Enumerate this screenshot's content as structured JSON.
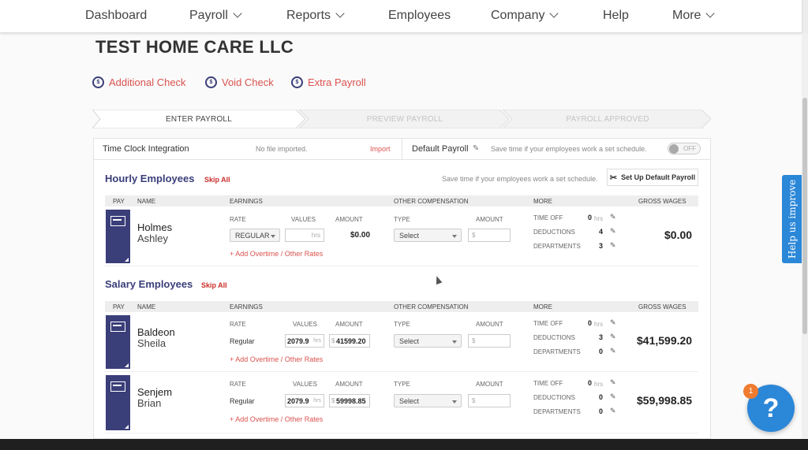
{
  "nav": {
    "items": [
      {
        "label": "Dashboard",
        "has_dropdown": false
      },
      {
        "label": "Payroll",
        "has_dropdown": true
      },
      {
        "label": "Reports",
        "has_dropdown": true
      },
      {
        "label": "Employees",
        "has_dropdown": false
      },
      {
        "label": "Company",
        "has_dropdown": true
      },
      {
        "label": "Help",
        "has_dropdown": false
      },
      {
        "label": "More",
        "has_dropdown": true
      }
    ]
  },
  "company_name": "TEST HOME CARE LLC",
  "actions": {
    "additional_check": "Additional Check",
    "void_check": "Void Check",
    "extra_payroll": "Extra Payroll"
  },
  "steps": {
    "enter": "ENTER PAYROLL",
    "preview": "PREVIEW PAYROLL",
    "approved": "PAYROLL APPROVED"
  },
  "timeclock": {
    "label": "Time Clock Integration",
    "status": "No file imported.",
    "import": "Import",
    "default_payroll": "Default Payroll",
    "hint": "Save time if your employees work a set schedule.",
    "toggle": "OFF"
  },
  "hourly": {
    "title": "Hourly Employees",
    "skip_all": "Skip All",
    "hint": "Save time if your employees work a set schedule.",
    "setup_button": "Set Up Default Payroll"
  },
  "salary": {
    "title": "Salary Employees",
    "skip_all": "Skip All"
  },
  "table_headers": {
    "pay": "PAY",
    "name": "NAME",
    "earnings": "EARNINGS",
    "other_comp": "OTHER COMPENSATION",
    "more": "MORE",
    "gross_wages": "GROSS WAGES"
  },
  "sub_headers": {
    "rate": "RATE",
    "values": "VALUES",
    "amount": "AMOUNT",
    "type": "TYPE",
    "time_off": "TIME OFF",
    "deductions": "DEDUCTIONS",
    "departments": "DEPARTMENTS",
    "hrs": "hrs",
    "dollar": "$",
    "add_overtime": "+ Add Overtime / Other Rates",
    "select": "Select"
  },
  "hourly_employees": [
    {
      "last": "Holmes",
      "first": "Ashley",
      "rate": "REGULAR",
      "hours": "",
      "amount": "$0.00",
      "time_off": "0",
      "deductions": "4",
      "departments": "3",
      "gross": "$0.00"
    }
  ],
  "salary_employees": [
    {
      "last": "Baldeon",
      "first": "Sheila",
      "rate": "Regular",
      "hours": "2079.9",
      "amount": "41599.20",
      "time_off": "0",
      "deductions": "3",
      "departments": "0",
      "gross": "$41,599.20"
    },
    {
      "last": "Senjem",
      "first": "Brian",
      "rate": "Regular",
      "hours": "2079.9",
      "amount": "59998.85",
      "time_off": "0",
      "deductions": "0",
      "departments": "0",
      "gross": "$59,998.85"
    }
  ],
  "help_tab": "Help us improve",
  "help_button": "?",
  "help_badge": "1",
  "colors": {
    "navy": "#3a3e79",
    "accent_red": "#d9534f",
    "help_blue": "#2b87d8",
    "badge_orange": "#f07b2e"
  }
}
